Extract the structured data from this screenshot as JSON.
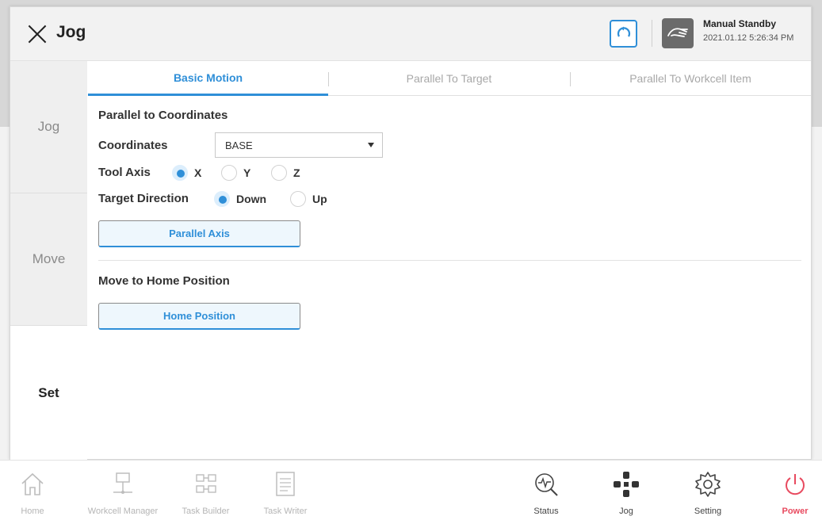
{
  "window": {
    "title": "Jog"
  },
  "status": {
    "mode": "Manual Standby",
    "datetime": "2021.01.12 5:26:34 PM"
  },
  "side_nav": {
    "items": [
      {
        "label": "Jog"
      },
      {
        "label": "Move"
      },
      {
        "label": "Set"
      }
    ],
    "selected": "Set"
  },
  "tabs": [
    {
      "label": "Basic Motion"
    },
    {
      "label": "Parallel To Target"
    },
    {
      "label": "Parallel To Workcell Item"
    }
  ],
  "active_tab": "Basic Motion",
  "parallel": {
    "section_title": "Parallel to Coordinates",
    "coordinates_label": "Coordinates",
    "coordinates_value": "BASE",
    "tool_axis_label": "Tool Axis",
    "tool_axis_options": [
      "X",
      "Y",
      "Z"
    ],
    "tool_axis_selected": "X",
    "target_direction_label": "Target Direction",
    "target_direction_options": [
      "Down",
      "Up"
    ],
    "target_direction_selected": "Down",
    "button_label": "Parallel Axis"
  },
  "home": {
    "section_title": "Move to Home Position",
    "button_label": "Home Position"
  },
  "bottom_nav": [
    {
      "label": "Home",
      "icon": "home-icon",
      "enabled": false
    },
    {
      "label": "Workcell Manager",
      "icon": "workcell-icon",
      "enabled": false
    },
    {
      "label": "Task Builder",
      "icon": "task-builder-icon",
      "enabled": false
    },
    {
      "label": "Task Writer",
      "icon": "task-writer-icon",
      "enabled": false
    },
    {
      "label": "Status",
      "icon": "status-icon",
      "enabled": true
    },
    {
      "label": "Jog",
      "icon": "jog-icon",
      "enabled": true
    },
    {
      "label": "Setting",
      "icon": "gear-icon",
      "enabled": true
    },
    {
      "label": "Power",
      "icon": "power-icon",
      "enabled": true
    }
  ],
  "colors": {
    "accent": "#2f8fd8",
    "power": "#e84a5f",
    "disabled": "#b5b5b5"
  }
}
